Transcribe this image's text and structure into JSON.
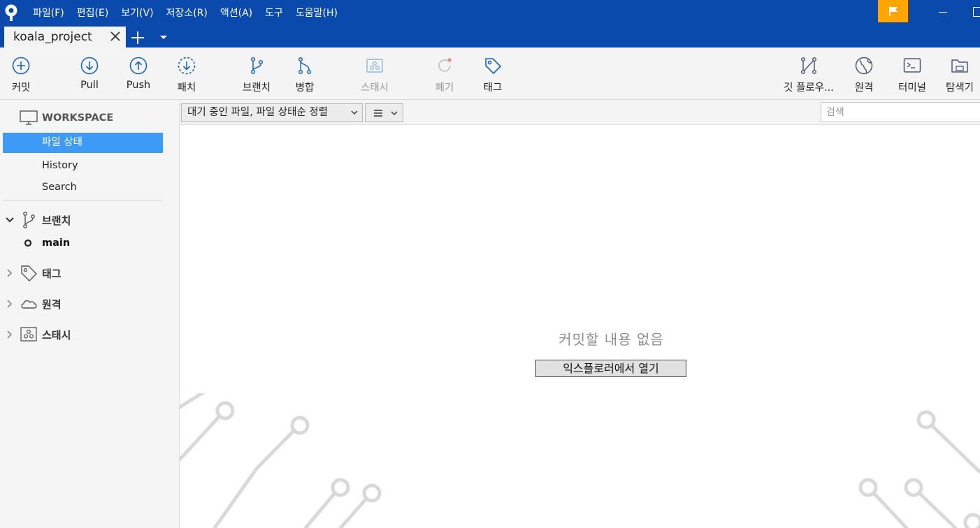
{
  "menu": [
    "파일(F)",
    "편집(E)",
    "보기(V)",
    "저장소(R)",
    "액션(A)",
    "도구",
    "도움말(H)"
  ],
  "tab": {
    "label": "koala_project"
  },
  "toolbar": {
    "commit": "커밋",
    "pull": "Pull",
    "push": "Push",
    "patch": "패치",
    "branch": "브랜치",
    "merge": "병합",
    "stash": "스태시",
    "discard": "폐기",
    "tag": "태그",
    "gitflow": "깃 플로우...",
    "remote": "원격",
    "terminal": "터미널",
    "explorer": "탐색기"
  },
  "sidebar": {
    "workspace": "WORKSPACE",
    "items": [
      "파일 상태",
      "History",
      "Search"
    ],
    "branches_label": "브랜치",
    "current_branch": "main",
    "tags_label": "태그",
    "remotes_label": "원격",
    "stash_label": "스태시"
  },
  "filterbar": {
    "filter": "대기 중인 파일, 파일 상태순 정렬",
    "search_placeholder": "검색"
  },
  "main": {
    "empty_message": "커밋할 내용 없음",
    "open_explorer": "익스플로러에서 열기"
  },
  "colors": {
    "titlebar": "#0b4aad",
    "accent_flag": "#ffa500",
    "selected": "#3d9bf5",
    "icon_blue": "#1565c0"
  }
}
